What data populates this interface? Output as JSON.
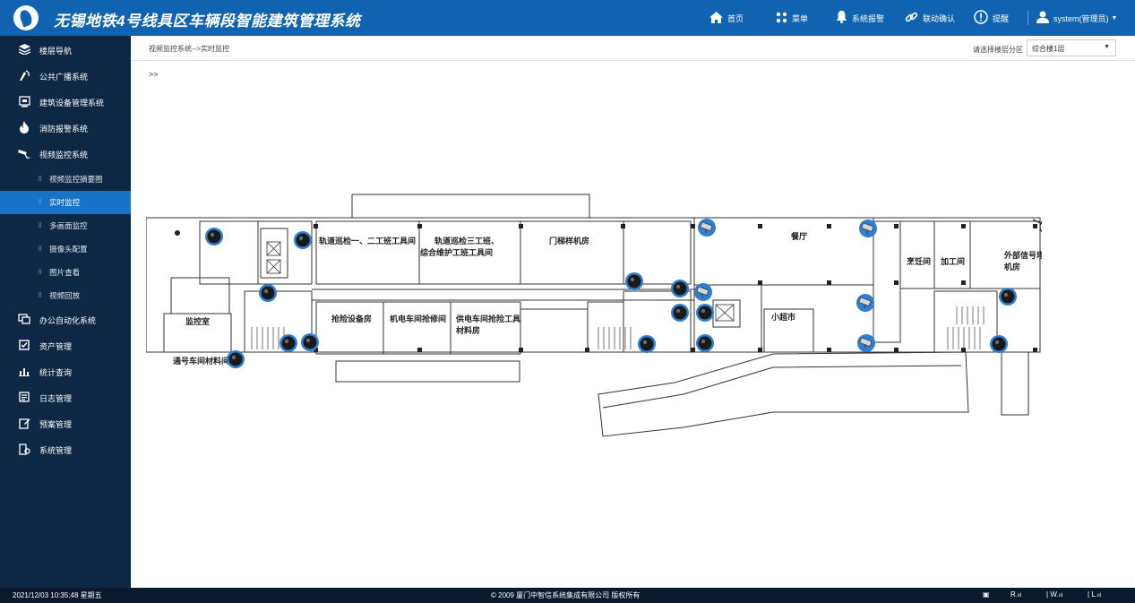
{
  "header": {
    "title": "无锡地铁4号线具区车辆段智能建筑管理系统",
    "nav": {
      "home": "首页",
      "menu": "菜单",
      "alarm": "系统报警",
      "link_confirm": "联动确认",
      "remind": "提醒",
      "user": "system(管理员)"
    }
  },
  "sidebar": {
    "items": [
      {
        "label": "楼层导航",
        "icon": "layers-icon"
      },
      {
        "label": "公共广播系统",
        "icon": "broadcast-icon"
      },
      {
        "label": "建筑设备管理系统",
        "icon": "building-device-icon"
      },
      {
        "label": "消防报警系统",
        "icon": "fire-icon"
      },
      {
        "label": "视频监控系统",
        "icon": "camera-icon"
      }
    ],
    "subitems": [
      {
        "label": "视频监控摘要图"
      },
      {
        "label": "实时监控",
        "active": true
      },
      {
        "label": "多画面监控"
      },
      {
        "label": "摄像头配置"
      },
      {
        "label": "图片查看"
      },
      {
        "label": "视频回放"
      }
    ],
    "items2": [
      {
        "label": "办公自动化系统",
        "icon": "office-icon"
      },
      {
        "label": "资产管理",
        "icon": "checkbox-icon"
      },
      {
        "label": "统计查询",
        "icon": "bar-chart-icon"
      },
      {
        "label": "日志管理",
        "icon": "log-icon"
      },
      {
        "label": "预案管理",
        "icon": "edit-icon"
      },
      {
        "label": "系统管理",
        "icon": "settings-icon"
      }
    ]
  },
  "content": {
    "breadcrumb": "视频监控系统-->实时监控",
    "floor_label": "请选择楼层分区",
    "floor_value": "综合楼1层",
    "arrows": ">>"
  },
  "floorplan": {
    "rooms": {
      "r1": "轨道巡检一、二工班工具间",
      "r2a": "轨道巡检三工班、",
      "r2b": "综合维护工班工具间",
      "r3": "门梯样机房",
      "r4": "餐厅",
      "r5": "烹饪间",
      "r6": "加工间",
      "r7a": "外部信号塔",
      "r7b": "机房",
      "r8": "监控室",
      "r9": "抢险设备房",
      "r10": "机电车间抢修间",
      "r11a": "供电车间抢险工具",
      "r11b": "材料房",
      "r12": "小超市",
      "r13": "通号车间材料间"
    }
  },
  "footer": {
    "datetime": "2021/12/03  10:35:48  星期五",
    "copyright": "© 2009 厦门中智信系统集成有限公司 版权所有",
    "status_r": "R",
    "status_w": "W",
    "status_l": "L"
  },
  "colors": {
    "header_bg": "#0f63b0",
    "sidebar_bg": "#0d2845",
    "active_bg": "#1773c8",
    "footer_bg": "#0a1a2e"
  }
}
